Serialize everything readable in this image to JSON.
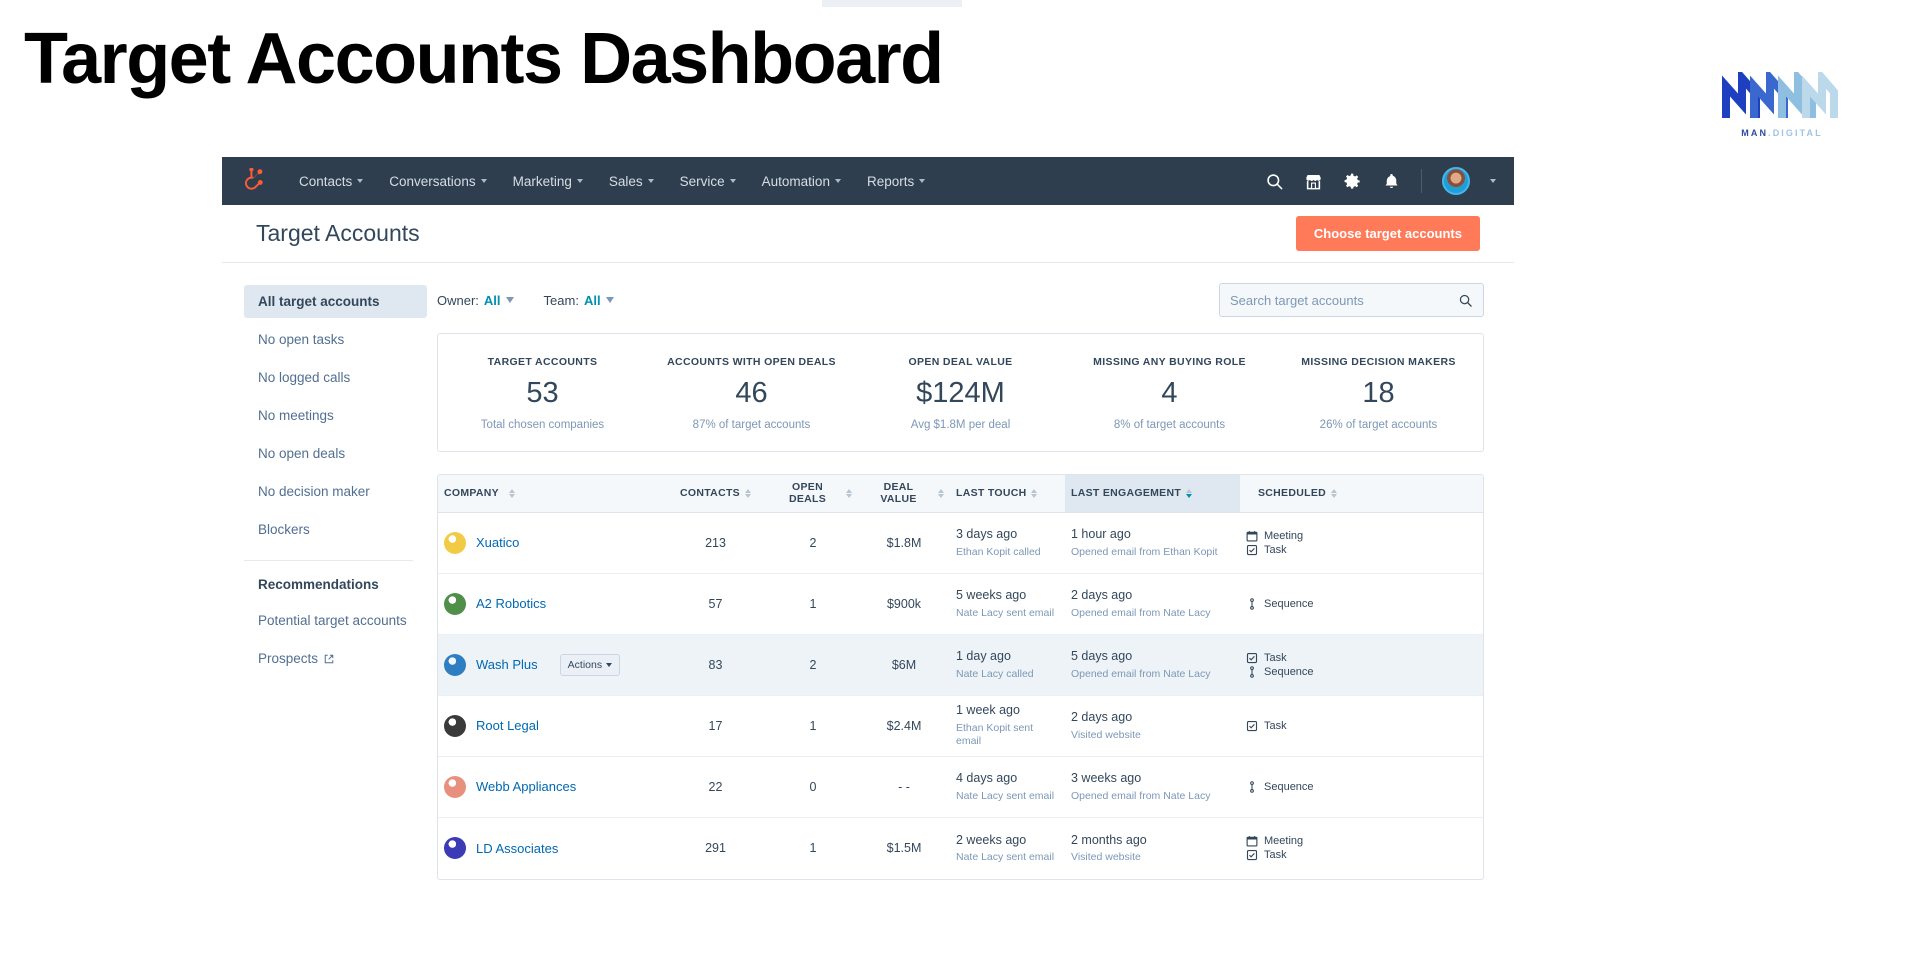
{
  "slide": {
    "title": "Target Accounts Dashboard",
    "logo": {
      "primary": "MAN",
      "separator": ".",
      "secondary": "DIGITAL"
    }
  },
  "navbar": {
    "brand": "hubspot-sprocket-logo",
    "items": [
      {
        "label": "Contacts"
      },
      {
        "label": "Conversations"
      },
      {
        "label": "Marketing"
      },
      {
        "label": "Sales"
      },
      {
        "label": "Service"
      },
      {
        "label": "Automation"
      },
      {
        "label": "Reports"
      }
    ],
    "icons": [
      "search-icon",
      "marketplace-icon",
      "settings-gear-icon",
      "notifications-bell-icon"
    ]
  },
  "page_head": {
    "title": "Target Accounts",
    "primary_button": "Choose target accounts"
  },
  "sidebar": {
    "views": [
      {
        "label": "All target accounts",
        "active": true
      },
      {
        "label": "No open tasks",
        "active": false
      },
      {
        "label": "No logged calls",
        "active": false
      },
      {
        "label": "No meetings",
        "active": false
      },
      {
        "label": "No open deals",
        "active": false
      },
      {
        "label": "No decision maker",
        "active": false
      },
      {
        "label": "Blockers",
        "active": false
      }
    ],
    "recommendations_heading": "Recommendations",
    "recommendations": [
      {
        "label": "Potential target accounts",
        "external": false
      },
      {
        "label": "Prospects",
        "external": true
      }
    ]
  },
  "filters": {
    "owner_label": "Owner:",
    "owner_value": "All",
    "team_label": "Team:",
    "team_value": "All"
  },
  "search": {
    "placeholder": "Search target accounts",
    "value": ""
  },
  "stats": [
    {
      "label": "TARGET ACCOUNTS",
      "value": "53",
      "sub": "Total chosen companies"
    },
    {
      "label": "ACCOUNTS WITH OPEN DEALS",
      "value": "46",
      "sub": "87% of target accounts"
    },
    {
      "label": "OPEN DEAL VALUE",
      "value": "$124M",
      "sub": "Avg $1.8M per deal"
    },
    {
      "label": "MISSING ANY BUYING ROLE",
      "value": "4",
      "sub": "8% of target accounts"
    },
    {
      "label": "MISSING DECISION MAKERS",
      "value": "18",
      "sub": "26% of target accounts"
    }
  ],
  "table": {
    "columns": [
      {
        "label": "COMPANY",
        "sorted": false
      },
      {
        "label": "CONTACTS",
        "sorted": false
      },
      {
        "label": "OPEN DEALS",
        "sorted": false
      },
      {
        "label": "DEAL VALUE",
        "sorted": false
      },
      {
        "label": "LAST TOUCH",
        "sorted": false
      },
      {
        "label": "LAST ENGAGEMENT",
        "sorted": true
      },
      {
        "label": "SCHEDULED",
        "sorted": false
      }
    ],
    "rows": [
      {
        "company": "Xuatico",
        "logo_color": "#f2cb46",
        "contacts": "213",
        "open_deals": "2",
        "deal_value": "$1.8M",
        "last_touch_main": "3 days ago",
        "last_touch_sub": "Ethan Kopit called",
        "last_engagement_main": "1 hour ago",
        "last_engagement_sub": "Opened email from Ethan Kopit",
        "scheduled": [
          "Meeting",
          "Task"
        ],
        "hovered": false,
        "actions_label": ""
      },
      {
        "company": "A2 Robotics",
        "logo_color": "#4f8f4a",
        "contacts": "57",
        "open_deals": "1",
        "deal_value": "$900k",
        "last_touch_main": "5 weeks ago",
        "last_touch_sub": "Nate Lacy sent email",
        "last_engagement_main": "2 days ago",
        "last_engagement_sub": "Opened email from Nate Lacy",
        "scheduled": [
          "Sequence"
        ],
        "hovered": false,
        "actions_label": ""
      },
      {
        "company": "Wash Plus",
        "logo_color": "#2d7fc1",
        "contacts": "83",
        "open_deals": "2",
        "deal_value": "$6M",
        "last_touch_main": "1 day ago",
        "last_touch_sub": "Nate Lacy called",
        "last_engagement_main": "5 days ago",
        "last_engagement_sub": "Opened email from Nate Lacy",
        "scheduled": [
          "Task",
          "Sequence"
        ],
        "hovered": true,
        "actions_label": "Actions"
      },
      {
        "company": "Root Legal",
        "logo_color": "#3a3a3a",
        "contacts": "17",
        "open_deals": "1",
        "deal_value": "$2.4M",
        "last_touch_main": "1 week ago",
        "last_touch_sub": "Ethan Kopit sent email",
        "last_engagement_main": "2 days ago",
        "last_engagement_sub": "Visited website",
        "scheduled": [
          "Task"
        ],
        "hovered": false,
        "actions_label": ""
      },
      {
        "company": "Webb Appliances",
        "logo_color": "#e8907e",
        "contacts": "22",
        "open_deals": "0",
        "deal_value": "- -",
        "last_touch_main": "4 days ago",
        "last_touch_sub": "Nate Lacy sent email",
        "last_engagement_main": "3 weeks ago",
        "last_engagement_sub": "Opened email from Nate Lacy",
        "scheduled": [
          "Sequence"
        ],
        "hovered": false,
        "actions_label": ""
      },
      {
        "company": "LD Associates",
        "logo_color": "#3b3bb5",
        "contacts": "291",
        "open_deals": "1",
        "deal_value": "$1.5M",
        "last_touch_main": "2 weeks ago",
        "last_touch_sub": "Nate Lacy sent email",
        "last_engagement_main": "2 months ago",
        "last_engagement_sub": "Visited website",
        "scheduled": [
          "Meeting",
          "Task"
        ],
        "hovered": false,
        "actions_label": ""
      }
    ]
  },
  "colors": {
    "nav_bg": "#2e3e4e",
    "accent_orange": "#ff7a59",
    "link_blue": "#0068b1",
    "filter_blue": "#0091ae",
    "text_dark": "#33475b",
    "text_muted": "#7c98b6"
  }
}
